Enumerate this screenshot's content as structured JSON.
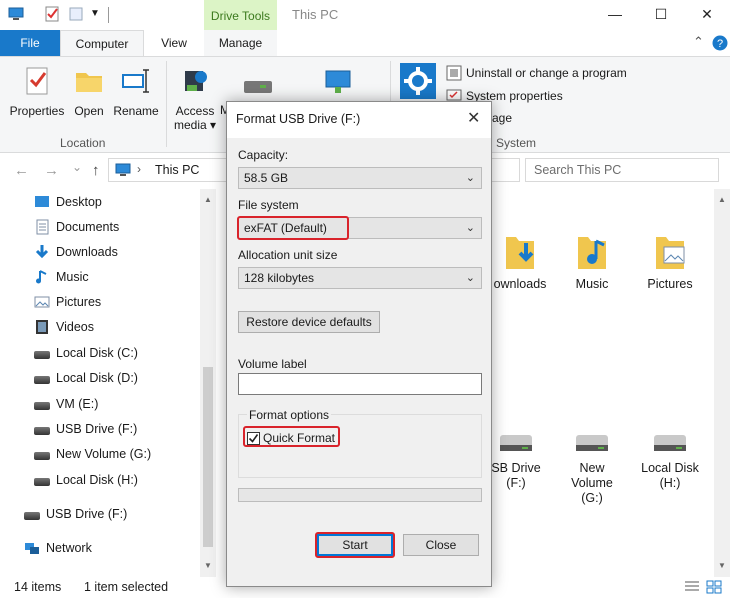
{
  "titlebar": {
    "contextual_tab": "Drive Tools",
    "window_title": "This PC",
    "minimize": "—",
    "maximize": "☐",
    "close": "✕"
  },
  "ribbon_tabs": {
    "file": "File",
    "computer": "Computer",
    "view": "View",
    "manage": "Manage",
    "collapse": "⌃"
  },
  "ribbon": {
    "location_group": "Location",
    "properties": "Properties",
    "open": "Open",
    "rename": "Rename",
    "access_media_line1": "Access",
    "access_media_line2": "media ▾",
    "partial_btn": "M",
    "system_group": "System",
    "uninstall": "Uninstall or change a program",
    "system_properties": "System properties",
    "manage_partial": "age"
  },
  "address": {
    "back": "←",
    "forward": "→",
    "up_list": "⌄",
    "up": "↑",
    "path_sep": "›",
    "path": "This PC",
    "search_placeholder": "Search This PC"
  },
  "nav": {
    "items": [
      {
        "label": "Desktop",
        "icon": "desktop-icon"
      },
      {
        "label": "Documents",
        "icon": "documents-icon"
      },
      {
        "label": "Downloads",
        "icon": "downloads-icon"
      },
      {
        "label": "Music",
        "icon": "music-icon"
      },
      {
        "label": "Pictures",
        "icon": "pictures-icon"
      },
      {
        "label": "Videos",
        "icon": "videos-icon"
      },
      {
        "label": "Local Disk (C:)",
        "icon": "drive-icon"
      },
      {
        "label": "Local Disk (D:)",
        "icon": "drive-icon"
      },
      {
        "label": "VM (E:)",
        "icon": "drive-icon"
      },
      {
        "label": "USB Drive (F:)",
        "icon": "drive-icon"
      },
      {
        "label": "New Volume (G:)",
        "icon": "drive-icon"
      },
      {
        "label": "Local Disk (H:)",
        "icon": "drive-icon"
      }
    ],
    "usb_root": "USB Drive (F:)",
    "network": "Network"
  },
  "content": {
    "folders": [
      "ownloads",
      "Music",
      "Pictures"
    ],
    "drives": [
      {
        "line1": "SB Drive",
        "line2": "(F:)"
      },
      {
        "line1": "New",
        "line2": "Volume",
        "line3": "(G:)"
      },
      {
        "line1": "Local Disk",
        "line2": "(H:)"
      }
    ]
  },
  "status": {
    "count": "14 items",
    "selected": "1 item selected"
  },
  "dialog": {
    "title": "Format USB Drive (F:)",
    "close": "✕",
    "capacity_label": "Capacity:",
    "capacity_value": "58.5 GB",
    "fs_label": "File system",
    "fs_value": "exFAT (Default)",
    "alloc_label": "Allocation unit size",
    "alloc_value": "128 kilobytes",
    "restore_btn": "Restore device defaults",
    "volume_label": "Volume label",
    "volume_value": "",
    "format_options": "Format options",
    "quick_format": "Quick Format",
    "quick_format_checked": true,
    "start_btn": "Start",
    "close_btn": "Close",
    "chevron": "⌄"
  },
  "colors": {
    "accent": "#1979ca",
    "highlight": "#d9232b",
    "drive_tools_bg": "#dcf4c6",
    "folder": "#f0c64e"
  }
}
